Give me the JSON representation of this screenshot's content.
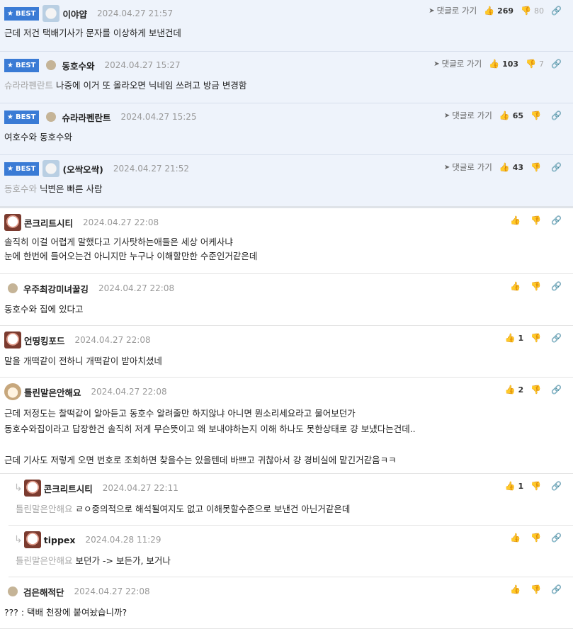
{
  "best_label": "BEST",
  "goto_label": "댓글로 가기",
  "comments": [
    {
      "nick": "이야얍",
      "date": "2024.04.27 21:57",
      "text": "근데 저건 택배기사가 문자를 이상하게 보낸건데",
      "up": "269",
      "down": "80"
    },
    {
      "nick": "동호수와",
      "date": "2024.04.27 15:27",
      "quote": "슈라라펜란트",
      "text": "나중에 이거 또 올라오면 닉네임 쓰려고 방금 변경함",
      "up": "103",
      "down": "7"
    },
    {
      "nick": "슈라라펜란트",
      "date": "2024.04.27 15:25",
      "text": "여호수와 동호수와",
      "up": "65"
    },
    {
      "nick": "(오싹오싹)",
      "date": "2024.04.27 21:52",
      "quote": "동호수와",
      "text": "닉변은 빠른 사람",
      "up": "43"
    },
    {
      "nick": "콘크리트시티",
      "date": "2024.04.27 22:08",
      "line1": "솔직히 이걸 어렵게 말했다고 기사탓하는애들은 세상 어케사냐",
      "line2": "눈에 한번에 들어오는건 아니지만 누구나 이해할만한 수준인거같은데"
    },
    {
      "nick": "우주최강미녀꿀깅",
      "date": "2024.04.27 22:08",
      "text": "동호수와 집에 있다고"
    },
    {
      "nick": "언띵킹포드",
      "date": "2024.04.27 22:08",
      "text": "말을 개떡같이 전하니 개떡같이 받아치셨네",
      "up": "1"
    },
    {
      "nick": "틀린말은안해요",
      "date": "2024.04.27 22:08",
      "line1": "근데 저정도는 찰떡같이 알아듣고 동호수 알려줄만 하지않냐 아니면 뭔소리세요라고 물어보던가",
      "line2": "동호수와집이라고 답장한건 솔직히 저게 무슨뜻이고 왜 보내야하는지 이해 하나도 못한상태로 걍 보냈다는건데..",
      "line3": "근데 기사도 저렇게 오면 번호로 조회하면 찾을수는 있을텐데 바쁘고 귀찮아서 걍 경비실에 맡긴거같음ㅋㅋ",
      "up": "2"
    },
    {
      "nick": "콘크리트시티",
      "date": "2024.04.27 22:11",
      "quote": "틀린말은안해요",
      "text": "ㄹㅇ중의적으로 해석될여지도 없고 이해못할수준으로 보낸건 아닌거같은데",
      "up": "1"
    },
    {
      "nick": "tippex",
      "date": "2024.04.28 11:29",
      "quote": "틀린말은안해요",
      "text": "보던가 -> 보든가, 보거나"
    },
    {
      "nick": "검은해적단",
      "date": "2024.04.27 22:08",
      "text": "??? : 택배 천장에 붙여놨습니까?"
    }
  ]
}
